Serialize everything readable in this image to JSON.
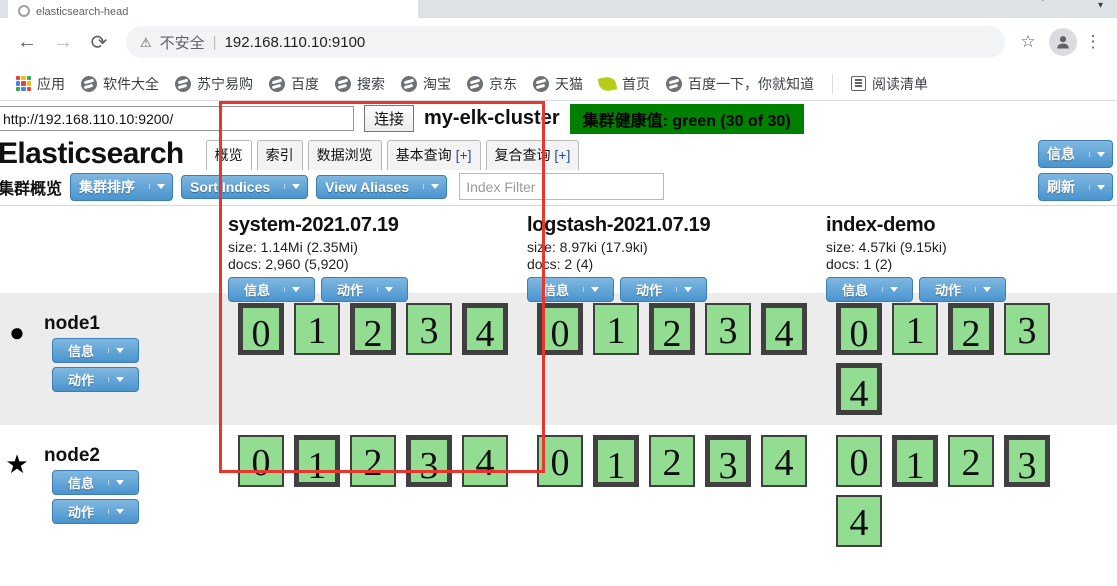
{
  "browser": {
    "tab_title": "elasticsearch-head",
    "back_icon": "back-arrow-icon",
    "forward_icon": "forward-arrow-icon",
    "reload_icon": "reload-icon",
    "not_secure_icon": "warning-triangle-icon",
    "not_secure_label": "不安全",
    "separator": "|",
    "url": "192.168.110.10:9100",
    "star_icon": "star-icon",
    "avatar_icon": "profile-avatar-icon",
    "menu_icon": "three-dot-menu-icon",
    "bookmarks": [
      {
        "label": "应用",
        "icon": "apps-grid-icon"
      },
      {
        "label": "软件大全",
        "icon": "globe-icon"
      },
      {
        "label": "苏宁易购",
        "icon": "globe-icon"
      },
      {
        "label": "百度",
        "icon": "globe-icon"
      },
      {
        "label": "搜索",
        "icon": "globe-icon"
      },
      {
        "label": "淘宝",
        "icon": "globe-icon"
      },
      {
        "label": "京东",
        "icon": "globe-icon"
      },
      {
        "label": "天猫",
        "icon": "globe-icon"
      },
      {
        "label": "首页",
        "icon": "leaf-icon"
      },
      {
        "label": "百度一下，你就知道",
        "icon": "globe-icon"
      }
    ],
    "reading_list": {
      "label": "阅读清单",
      "icon": "reading-list-icon"
    }
  },
  "app": {
    "connect_url": "http://192.168.110.10:9200/",
    "connect_button": "连接",
    "cluster_name": "my-elk-cluster",
    "health_badge": "集群健康值: green (30 of 30)",
    "logo": "Elasticsearch",
    "tabs": [
      {
        "label": "概览",
        "plus": "",
        "active": true
      },
      {
        "label": "索引",
        "plus": "",
        "active": false
      },
      {
        "label": "数据浏览",
        "plus": "",
        "active": false
      },
      {
        "label": "基本查询",
        "plus": "[+]",
        "active": false
      },
      {
        "label": "复合查询",
        "plus": "[+]",
        "active": false
      }
    ],
    "info_button": "信息",
    "toolbar": {
      "section_title": "集群概览",
      "sort_cluster": "集群排序",
      "sort_indices": "Sort Indices",
      "view_aliases": "View Aliases",
      "filter_placeholder": "Index Filter",
      "filter_value": "",
      "refresh": "刷新"
    },
    "buttons": {
      "info": "信息",
      "action": "动作"
    },
    "accent_blue": "#4a94ce",
    "health_green": "#008000",
    "shard_green": "#93dd93",
    "annotation_color": "#e8362c"
  },
  "cluster": {
    "indices": [
      {
        "name": "system-2021.07.19",
        "size": "size: 1.14Mi (2.35Mi)",
        "docs": "docs: 2,960 (5,920)"
      },
      {
        "name": "logstash-2021.07.19",
        "size": "size: 8.97ki (17.9ki)",
        "docs": "docs: 2 (4)"
      },
      {
        "name": "index-demo",
        "size": "size: 4.57ki (9.15ki)",
        "docs": "docs: 1 (2)"
      }
    ],
    "nodes": [
      {
        "name": "node1",
        "marker": "circle",
        "marker_glyph": "●",
        "shards": [
          [
            {
              "n": "0",
              "type": "primary"
            },
            {
              "n": "1",
              "type": "replica"
            },
            {
              "n": "2",
              "type": "primary"
            },
            {
              "n": "3",
              "type": "replica"
            },
            {
              "n": "4",
              "type": "primary"
            }
          ],
          [
            {
              "n": "0",
              "type": "primary"
            },
            {
              "n": "1",
              "type": "replica"
            },
            {
              "n": "2",
              "type": "primary"
            },
            {
              "n": "3",
              "type": "replica"
            },
            {
              "n": "4",
              "type": "primary"
            }
          ],
          [
            {
              "n": "0",
              "type": "primary"
            },
            {
              "n": "1",
              "type": "replica"
            },
            {
              "n": "2",
              "type": "primary"
            },
            {
              "n": "3",
              "type": "replica"
            },
            {
              "n": "4",
              "type": "primary"
            }
          ]
        ]
      },
      {
        "name": "node2",
        "marker": "star",
        "marker_glyph": "★",
        "shards": [
          [
            {
              "n": "0",
              "type": "replica"
            },
            {
              "n": "1",
              "type": "primary"
            },
            {
              "n": "2",
              "type": "replica"
            },
            {
              "n": "3",
              "type": "primary"
            },
            {
              "n": "4",
              "type": "replica"
            }
          ],
          [
            {
              "n": "0",
              "type": "replica"
            },
            {
              "n": "1",
              "type": "primary"
            },
            {
              "n": "2",
              "type": "replica"
            },
            {
              "n": "3",
              "type": "primary"
            },
            {
              "n": "4",
              "type": "replica"
            }
          ],
          [
            {
              "n": "0",
              "type": "replica"
            },
            {
              "n": "1",
              "type": "primary"
            },
            {
              "n": "2",
              "type": "replica"
            },
            {
              "n": "3",
              "type": "primary"
            },
            {
              "n": "4",
              "type": "replica"
            }
          ]
        ]
      }
    ]
  }
}
